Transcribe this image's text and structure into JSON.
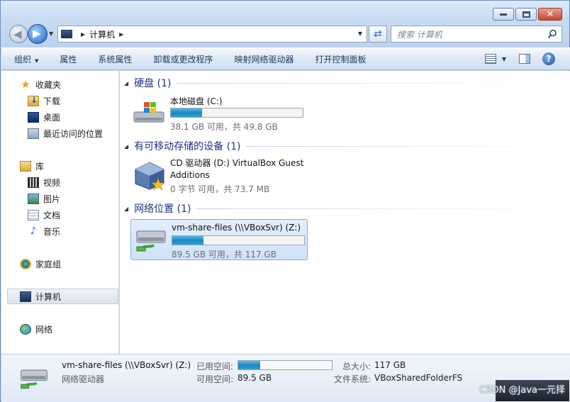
{
  "window": {
    "address": {
      "segments": [
        "计算机"
      ]
    },
    "search": {
      "placeholder": "搜索 计算机"
    }
  },
  "toolbar": {
    "organize": "组织",
    "properties": "属性",
    "system_properties": "系统属性",
    "uninstall": "卸载或更改程序",
    "map_drive": "映射网络驱动器",
    "control_panel": "打开控制面板"
  },
  "navpane": {
    "favorites": "收藏夹",
    "downloads": "下载",
    "desktop": "桌面",
    "recent": "最近访问的位置",
    "libraries": "库",
    "videos": "视频",
    "pictures": "图片",
    "documents": "文档",
    "music": "音乐",
    "homegroup": "家庭组",
    "computer": "计算机",
    "network": "网络"
  },
  "groups": {
    "hdd": "硬盘 (1)",
    "removable": "有可移动存储的设备 (1)",
    "network": "网络位置 (1)"
  },
  "drives": {
    "c": {
      "name": "本地磁盘 (C:)",
      "info": "38.1 GB 可用，共 49.8 GB",
      "used_fraction": 0.235
    },
    "d": {
      "name": "CD 驱动器 (D:) VirtualBox Guest Additions",
      "info": "0 字节 可用，共 73.7 MB"
    },
    "z": {
      "name": "vm-share-files (\\\\VBoxSvr) (Z:)",
      "info": "89.5 GB 可用，共 117 GB",
      "used_fraction": 0.235
    }
  },
  "details": {
    "name": "vm-share-files (\\\\VBoxSvr) (Z:)",
    "type": "网络驱动器",
    "used_label": "已用空间:",
    "free_label": "可用空间:",
    "free_value": "89.5 GB",
    "total_label": "总大小:",
    "total_value": "117 GB",
    "fs_label": "文件系统:",
    "fs_value": "VBoxSharedFolderFS",
    "used_fraction": 0.235
  },
  "watermark": "CSDN @Java一元择"
}
